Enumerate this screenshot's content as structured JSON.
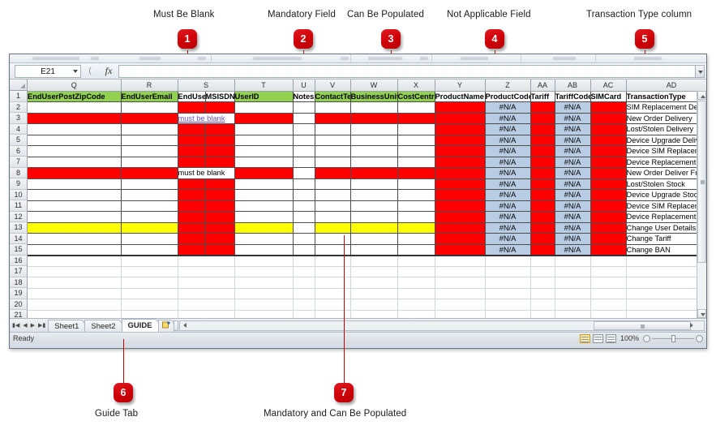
{
  "callouts": [
    {
      "num": "1",
      "label": "Must Be Blank"
    },
    {
      "num": "2",
      "label": "Mandatory Field"
    },
    {
      "num": "3",
      "label": "Can Be Populated"
    },
    {
      "num": "4",
      "label": "Not Applicable Field"
    },
    {
      "num": "5",
      "label": "Transaction Type column"
    },
    {
      "num": "6",
      "label": "Guide Tab"
    },
    {
      "num": "7",
      "label": "Mandatory and Can Be Populated"
    }
  ],
  "formula_bar": {
    "name_box": "E21",
    "fx_label": "fx",
    "formula_value": ""
  },
  "grid": {
    "column_letters": [
      "Q",
      "R",
      "S",
      "T",
      "U",
      "V",
      "W",
      "X",
      "Y",
      "Z",
      "AA",
      "AB",
      "AC",
      "AD"
    ],
    "row_numbers": [
      "1",
      "2",
      "3",
      "4",
      "5",
      "6",
      "7",
      "8",
      "9",
      "10",
      "11",
      "12",
      "13",
      "14",
      "15",
      "16",
      "17",
      "18",
      "19",
      "20",
      "21"
    ],
    "headers": [
      "EndUserPostZipCode",
      "EndUserEmail",
      "EndUser",
      "MSISDN",
      "UserID",
      "Notes",
      "ContactTel",
      "BusinessUnit",
      "CostCentre",
      "ProductName",
      "ProductCode",
      "Tariff",
      "TariffCode",
      "SIMCard",
      "TransactionType"
    ],
    "na_value": "#N/A",
    "must_be_blank": "must be blank",
    "transaction_types": [
      "SIM Replacement Delivery",
      "New Order Delivery",
      "Lost/Stolen Delivery",
      "Device Upgrade Delivery",
      "Device SIM Replacement Del",
      "Device Replacement Deliver",
      "New Order Deliver From Sto",
      "Lost/Stolen Stock",
      "Device Upgrade Stock",
      "Device SIM Replacement Sto",
      "Device Replacement Stock",
      "Change User Details",
      "Change Tariff",
      "Change BAN"
    ]
  },
  "sheet_tabs": {
    "items": [
      "Sheet1",
      "Sheet2",
      "GUIDE"
    ],
    "active": "GUIDE",
    "new_sheet_label": ""
  },
  "status_bar": {
    "state": "Ready",
    "zoom": "100%"
  },
  "colors": {
    "green_header": "#92d050",
    "red_cell": "#ff0000",
    "yellow_cell": "#ffff00",
    "blue_cell": "#b8cce4",
    "badge_red": "#d10a11"
  }
}
